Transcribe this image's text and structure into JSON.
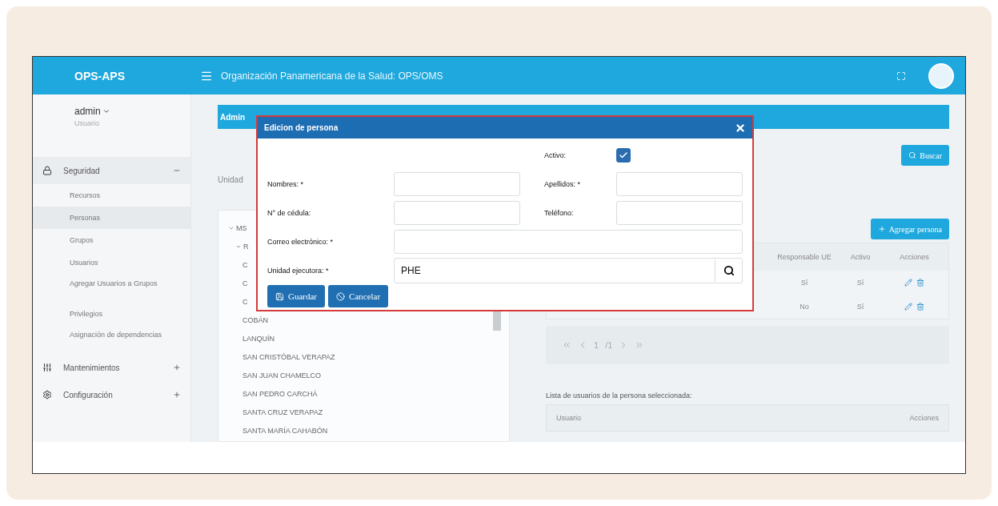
{
  "header": {
    "brand": "OPS-APS",
    "title": "Organización Panamericana de la Salud: OPS/OMS"
  },
  "user": {
    "name": "admin",
    "role": "Usuario"
  },
  "menu": [
    {
      "label": "Seguridad",
      "expanded": true,
      "children": [
        {
          "label": "Recursos",
          "selected": false
        },
        {
          "label": "Personas",
          "selected": true
        },
        {
          "label": "Grupos",
          "selected": false
        },
        {
          "label": "Usuarios",
          "selected": false
        },
        {
          "label": "Agregar Usuarios a Grupos",
          "selected": false
        },
        {
          "label": "Privilegios",
          "selected": false
        },
        {
          "label": "Asignación de dependencias",
          "selected": false
        }
      ]
    },
    {
      "label": "Mantenimientos",
      "expanded": false
    },
    {
      "label": "Configuración",
      "expanded": false
    }
  ],
  "page": {
    "title": "Admin",
    "unit_label": "Unidad",
    "tree": [
      {
        "label": "MS",
        "expanded": true,
        "children": [
          {
            "label": "R",
            "expanded": true,
            "children": [
              {
                "label": "C"
              },
              {
                "label": "C"
              },
              {
                "label": "C"
              },
              {
                "label": "COBÁN"
              },
              {
                "label": "LANQUÍN"
              },
              {
                "label": "SAN CRISTÓBAL VERAPAZ"
              },
              {
                "label": "SAN JUAN CHAMELCO"
              },
              {
                "label": "SAN PEDRO CARCHÁ"
              },
              {
                "label": "SANTA CRUZ VERAPAZ"
              },
              {
                "label": "SANTA MARÍA CAHABÓN"
              }
            ]
          }
        ]
      }
    ]
  },
  "search_button": "Buscar",
  "add_button": "Agregar persona",
  "persons_table": {
    "columns": [
      "Responsable UE",
      "Activo",
      "Acciones"
    ],
    "rows": [
      {
        "responsable_ue": "Sí",
        "activo": "Sí"
      },
      {
        "responsable_ue": "No",
        "activo": "Sí"
      }
    ]
  },
  "pagination": {
    "page": "1",
    "total": "/1"
  },
  "users_list": {
    "title": "Lista de usuarios de la persona seleccionada:",
    "columns": [
      "Usuario",
      "Acciones"
    ]
  },
  "dialog": {
    "title": "Edicion de persona",
    "active": {
      "label": "Activo:",
      "checked": true
    },
    "fields": [
      {
        "label": "Nombres: *",
        "kind": "half"
      },
      {
        "label": "Apellidos: *",
        "kind": "half"
      },
      {
        "label": "N° de cédula:",
        "kind": "half"
      },
      {
        "label": "Teléfono:",
        "kind": "half"
      },
      {
        "label": "Correo electrónico: *",
        "kind": "wide"
      },
      {
        "label": "Unidad ejecutora: *",
        "kind": "lookup",
        "value": "PHE"
      }
    ],
    "buttons": [
      {
        "label": "Guardar",
        "kind": "save"
      },
      {
        "label": "Cancelar",
        "kind": "cancel"
      }
    ]
  }
}
